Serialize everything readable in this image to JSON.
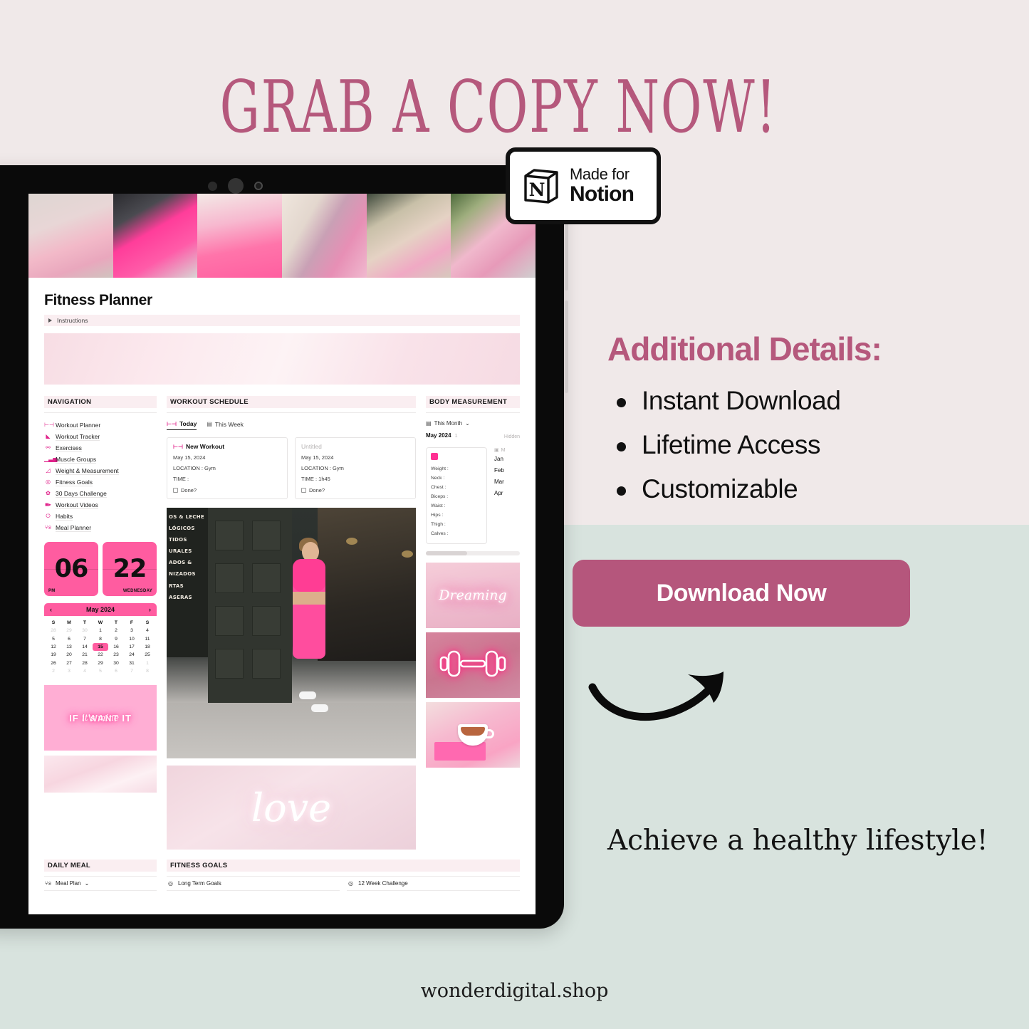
{
  "theme": {
    "bg_top": "#f0e9e9",
    "bg_bottom": "#d8e3de",
    "accent_rose": "#b5587c",
    "accent_pink": "#ff5ca0",
    "notion_pink": "#e0218a"
  },
  "headline": "GRAB A COPY NOW!",
  "badge": {
    "line1": "Made for",
    "line2": "Notion",
    "logo": "notion-cube-icon"
  },
  "right_panel": {
    "title": "Additional Details:",
    "bullets": [
      "Instant Download",
      "Lifetime Access",
      "Customizable"
    ],
    "download_button": "Download Now",
    "arrow": "curved-arrow-icon",
    "tagline": "Achieve a healthy lifestyle!"
  },
  "footer": "wonderdigital.shop",
  "tablet": {
    "page_title": "Fitness Planner",
    "instructions_toggle": "Instructions",
    "navigation": {
      "heading": "NAVIGATION",
      "items": [
        {
          "label": "Workout Planner",
          "icon": "dumbbell-icon"
        },
        {
          "label": "Workout Tracker",
          "icon": "sneaker-icon"
        },
        {
          "label": "Exercises",
          "icon": "people-icon"
        },
        {
          "label": "Muscle Groups",
          "icon": "chart-bars-icon"
        },
        {
          "label": "Weight & Measurement",
          "icon": "ruler-icon"
        },
        {
          "label": "Fitness Goals",
          "icon": "target-icon"
        },
        {
          "label": "30 Days Challenge",
          "icon": "gear-icon"
        },
        {
          "label": "Workout Videos",
          "icon": "video-camera-icon"
        },
        {
          "label": "Habits",
          "icon": "power-icon"
        },
        {
          "label": "Meal Planner",
          "icon": "fork-plate-icon"
        }
      ]
    },
    "clock": {
      "hour": "06",
      "meridiem": "PM",
      "day_number": "22",
      "weekday": "WEDNESDAY"
    },
    "calendar": {
      "month_label": "May 2024",
      "prev": "‹",
      "next": "›",
      "dow": [
        "S",
        "M",
        "T",
        "W",
        "T",
        "F",
        "S"
      ],
      "weeks": [
        [
          {
            "d": "28",
            "out": true
          },
          {
            "d": "29",
            "out": true
          },
          {
            "d": "30",
            "out": true
          },
          {
            "d": "1"
          },
          {
            "d": "2"
          },
          {
            "d": "3"
          },
          {
            "d": "4"
          }
        ],
        [
          {
            "d": "5"
          },
          {
            "d": "6"
          },
          {
            "d": "7"
          },
          {
            "d": "8"
          },
          {
            "d": "9"
          },
          {
            "d": "10"
          },
          {
            "d": "11"
          }
        ],
        [
          {
            "d": "12"
          },
          {
            "d": "13"
          },
          {
            "d": "14"
          },
          {
            "d": "15",
            "sel": true
          },
          {
            "d": "16"
          },
          {
            "d": "17"
          },
          {
            "d": "18"
          }
        ],
        [
          {
            "d": "19"
          },
          {
            "d": "20"
          },
          {
            "d": "21"
          },
          {
            "d": "22"
          },
          {
            "d": "23"
          },
          {
            "d": "24"
          },
          {
            "d": "25"
          }
        ],
        [
          {
            "d": "26"
          },
          {
            "d": "27"
          },
          {
            "d": "28"
          },
          {
            "d": "29"
          },
          {
            "d": "30"
          },
          {
            "d": "31"
          },
          {
            "d": "1",
            "out": true
          }
        ],
        [
          {
            "d": "2",
            "out": true
          },
          {
            "d": "3",
            "out": true
          },
          {
            "d": "4",
            "out": true
          },
          {
            "d": "5",
            "out": true
          },
          {
            "d": "6",
            "out": true
          },
          {
            "d": "7",
            "out": true
          },
          {
            "d": "8",
            "out": true
          }
        ]
      ]
    },
    "neon_want": {
      "line_main": "IF I WANT IT",
      "line_script": "it's mine"
    },
    "workout_schedule": {
      "heading": "WORKOUT SCHEDULE",
      "tabs": [
        {
          "label": "Today",
          "active": true,
          "icon": "dumbbell-icon"
        },
        {
          "label": "This Week",
          "active": false,
          "icon": "calendar-icon"
        }
      ],
      "cards": [
        {
          "title": "New Workout",
          "dimmed": false,
          "date": "May 15, 2024",
          "location": "LOCATION : Gym",
          "time": "TIME :",
          "done": "Done?"
        },
        {
          "title": "Untitled",
          "dimmed": true,
          "date": "May 15, 2024",
          "location": "LOCATION : Gym",
          "time": "TIME : 1h45",
          "done": "Done?"
        }
      ]
    },
    "hero_photo": {
      "alt": "woman-in-pink-activewear-photo",
      "sign_lines": [
        "OS & LECHE",
        "LÓGICOS",
        "TIDOS",
        "URALES",
        "ADOS &",
        "NIZADOS",
        "RTAS",
        "ASERAS"
      ]
    },
    "neon_love": "love",
    "body_measurement": {
      "heading": "BODY MEASUREMENT",
      "filter": "This Month",
      "group_label": "May 2024",
      "group_count": "1",
      "hidden_label": "Hidden",
      "fields": [
        "Weight :",
        "Neck :",
        "Chest :",
        "Biceps :",
        "Waist :",
        "Hips :",
        "Thigh :",
        "Calves :"
      ],
      "months": [
        "Jan",
        "Feb",
        "Mar",
        "Apr"
      ],
      "months_title": "M"
    },
    "mini_images": [
      {
        "name": "dreaming-neon-image",
        "text": "Dreaming"
      },
      {
        "name": "neon-dumbbell-image",
        "text": ""
      },
      {
        "name": "pink-tea-cup-image",
        "text": ""
      }
    ],
    "daily_meal": {
      "heading": "DAILY MEAL",
      "item": "Meal Plan",
      "icon": "fork-plate-icon"
    },
    "fitness_goals": {
      "heading": "FITNESS GOALS",
      "items": [
        {
          "label": "Long Term Goals",
          "icon": "target-icon"
        },
        {
          "label": "12 Week Challenge",
          "icon": "target-icon"
        }
      ]
    }
  }
}
